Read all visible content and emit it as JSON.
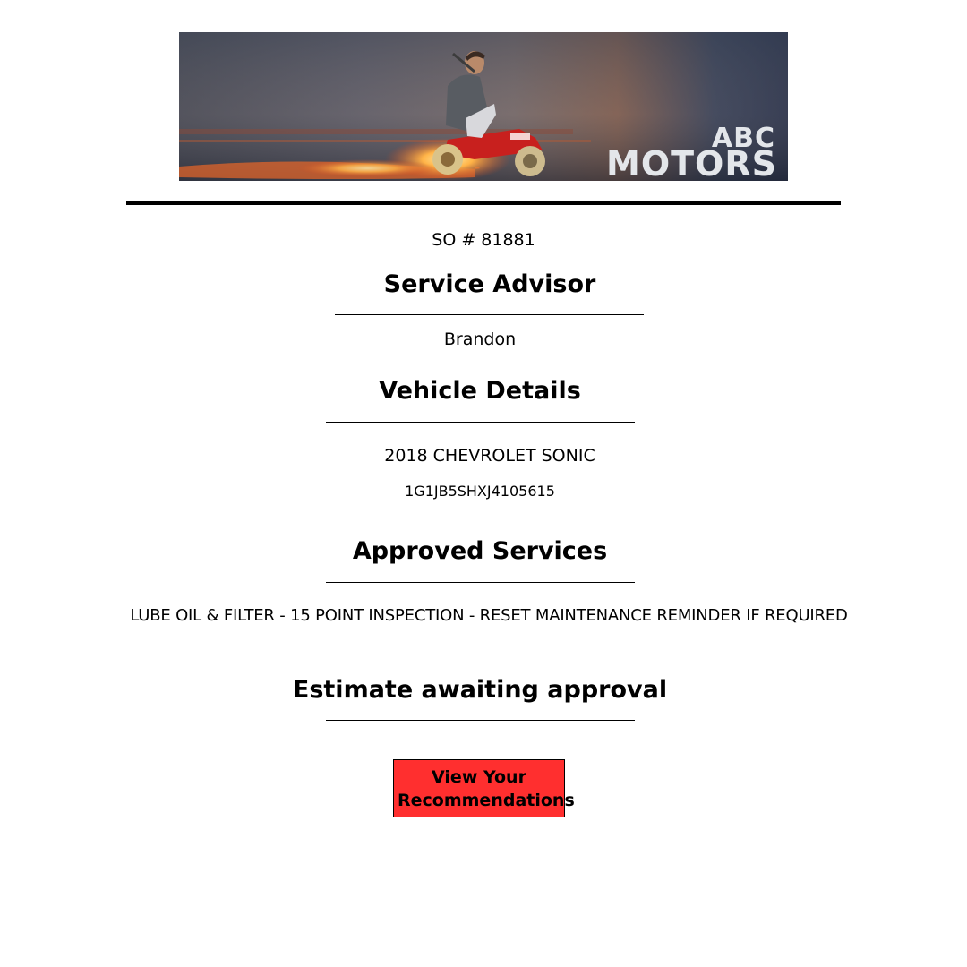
{
  "brand": {
    "logo_line1": "ABC",
    "logo_line2": "MOTORS"
  },
  "service_order": {
    "so_number": "SO # 81881"
  },
  "service_advisor": {
    "heading": "Service Advisor",
    "name": "Brandon"
  },
  "vehicle": {
    "heading": "Vehicle Details",
    "description": "2018 CHEVROLET SONIC",
    "vin": "1G1JB5SHXJ4105615"
  },
  "approved_services": {
    "heading": "Approved Services",
    "items": "LUBE OIL & FILTER - 15 POINT INSPECTION - RESET MAINTENANCE REMINDER IF REQUIRED"
  },
  "estimate": {
    "heading": "Estimate awaiting approval"
  },
  "cta": {
    "line1": "View Your",
    "line2": "Recommendations",
    "color": "#ff2f2f"
  }
}
